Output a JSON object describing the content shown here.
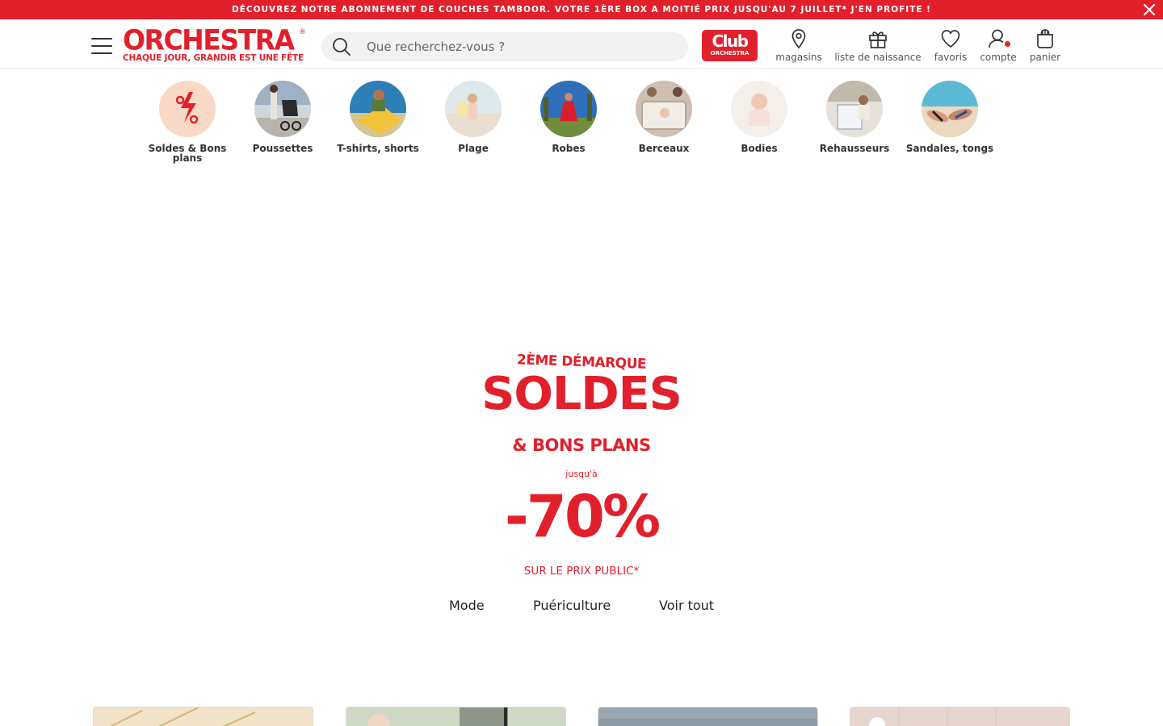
{
  "promo": {
    "text": "DÉCOUVREZ NOTRE ABONNEMENT DE COUCHES TAMBOOR. VOTRE 1ÈRE BOX A MOITIÉ PRIX JUSQU'AU 7 JUILLET* J'EN PROFITE !",
    "close_icon": "close-icon"
  },
  "header": {
    "logo_word": "ORCHESTRA",
    "logo_reg": "®",
    "logo_tagline": "CHAQUE JOUR, GRANDIR EST UNE FÊTE",
    "search_placeholder": "Que recherchez-vous ?",
    "club_main": "Club",
    "club_sub": "ORCHESTRA",
    "nav": [
      {
        "label": "magasins",
        "icon": "location-pin-icon"
      },
      {
        "label": "liste de naissance",
        "icon": "gift-icon"
      },
      {
        "label": "favoris",
        "icon": "heart-icon"
      },
      {
        "label": "compte",
        "icon": "user-icon"
      },
      {
        "label": "panier",
        "icon": "bag-icon"
      }
    ]
  },
  "categories": [
    {
      "label": "Soldes & Bons plans"
    },
    {
      "label": "Poussettes"
    },
    {
      "label": "T-shirts, shorts"
    },
    {
      "label": "Plage"
    },
    {
      "label": "Robes"
    },
    {
      "label": "Berceaux"
    },
    {
      "label": "Bodies"
    },
    {
      "label": "Rehausseurs"
    },
    {
      "label": "Sandales, tongs"
    }
  ],
  "hero": {
    "line1": "2ÈME DÉMARQUE",
    "big": "SOLDES",
    "line2": "& BONS PLANS",
    "small": "jusqu'à",
    "pct": "-70%",
    "note": "SUR LE PRIX PUBLIC*",
    "links": [
      "Mode",
      "Puériculture",
      "Voir tout"
    ]
  },
  "colors": {
    "brand_red": "#e2202c"
  }
}
